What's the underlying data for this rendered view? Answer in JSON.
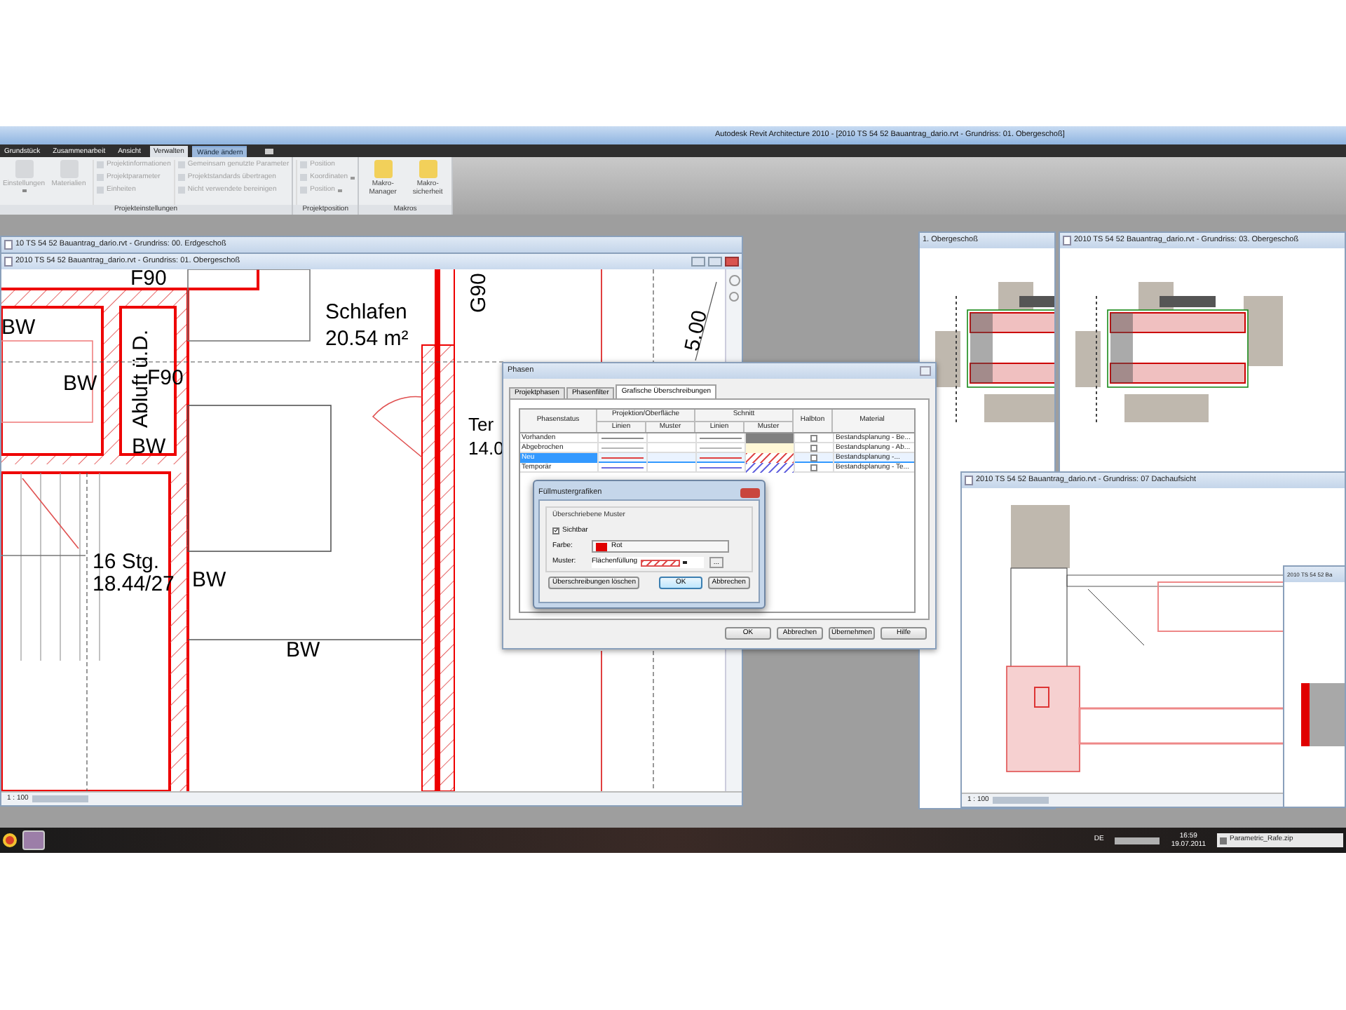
{
  "app_title": "Autodesk Revit Architecture 2010 - [2010 TS 54 52 Bauantrag_dario.rvt - Grundriss: 01. Obergeschoß]",
  "ribbon_tabs": [
    {
      "label": "Grundstück",
      "selected": false,
      "kind": "normal"
    },
    {
      "label": "Zusammenarbeit",
      "selected": false,
      "kind": "normal"
    },
    {
      "label": "Ansicht",
      "selected": false,
      "kind": "normal"
    },
    {
      "label": "Verwalten",
      "selected": true,
      "kind": "normal"
    },
    {
      "label": "Wände ändern",
      "selected": false,
      "kind": "contextual"
    }
  ],
  "ribbon_panels": [
    {
      "label": "Projekteinstellungen",
      "columns": [
        {
          "kind": "large",
          "items": [
            {
              "label": "Einstellungen",
              "dropdown": true,
              "disabled": true
            }
          ]
        },
        {
          "kind": "large",
          "items": [
            {
              "label": "Materialien",
              "dropdown": false,
              "disabled": true
            }
          ]
        },
        {
          "kind": "small",
          "items": [
            {
              "label": "Projektinformationen",
              "dropdown": false,
              "disabled": true
            },
            {
              "label": "Projektparameter",
              "dropdown": false,
              "disabled": true
            },
            {
              "label": "Einheiten",
              "dropdown": false,
              "disabled": true
            }
          ]
        },
        {
          "kind": "small",
          "items": [
            {
              "label": "Gemeinsam genutzte Parameter",
              "dropdown": false,
              "disabled": true
            },
            {
              "label": "Projektstandards übertragen",
              "dropdown": false,
              "disabled": true
            },
            {
              "label": "Nicht verwendete bereinigen",
              "dropdown": false,
              "disabled": true
            }
          ]
        }
      ]
    },
    {
      "label": "Projektposition",
      "columns": [
        {
          "kind": "small",
          "items": [
            {
              "label": "Position",
              "dropdown": false,
              "disabled": true
            },
            {
              "label": "Koordinaten",
              "dropdown": true,
              "disabled": true
            },
            {
              "label": "Position",
              "dropdown": true,
              "disabled": true
            }
          ]
        }
      ]
    },
    {
      "label": "Makros",
      "columns": [
        {
          "kind": "large",
          "items": [
            {
              "label": "Makro-Manager",
              "dropdown": false,
              "disabled": false
            }
          ]
        },
        {
          "kind": "large",
          "items": [
            {
              "label": "Makro-sicherheit",
              "dropdown": false,
              "disabled": false
            }
          ]
        }
      ]
    }
  ],
  "back_window": {
    "title": "10 TS 54 52 Bauantrag_dario.rvt - Grundriss: 00. Erdgeschoß"
  },
  "main_window": {
    "title": "2010 TS 54 52 Bauantrag_dario.rvt - Grundriss: 01. Obergeschoß",
    "scale": "1 : 100",
    "plan_labels": [
      "F90",
      "BW",
      "BW",
      "Abluft ü.D.",
      "F90",
      "BW",
      "Schlafen",
      "20.54 m²",
      "G90",
      "5.00",
      "Ter",
      "14.0",
      "16 Stg.",
      "18.44/27",
      "BW",
      "BW"
    ]
  },
  "views": [
    {
      "title": "1. Obergeschoß"
    },
    {
      "title": "2010 TS 54 52 Bauantrag_dario.rvt - Grundriss: 03. Obergeschoß"
    },
    {
      "title": "2010 TS 54 52 Bauantrag_dario.rvt - Grundriss: 07 Dachaufsicht",
      "scale": "1 : 100"
    },
    {
      "title": "2010 TS 54 52 Ba"
    }
  ],
  "phases_dialog": {
    "title": "Phasen",
    "tabs": [
      {
        "label": "Projektphasen",
        "selected": false
      },
      {
        "label": "Phasenfilter",
        "selected": false
      },
      {
        "label": "Grafische Überschreibungen",
        "selected": true
      }
    ],
    "headers": {
      "status": "Phasenstatus",
      "projection": "Projektion/Oberfläche",
      "section": "Schnitt",
      "halftone": "Halbton",
      "material": "Material",
      "sub": [
        "Linien",
        "Muster",
        "Linien",
        "Muster"
      ]
    },
    "rows": [
      {
        "status": "Vorhanden",
        "selected": false,
        "color": "#8c8c8c",
        "section_pattern": {
          "kind": "solid",
          "color": "#808080"
        },
        "halftone": false,
        "material": "Bestandsplanung - Be..."
      },
      {
        "status": "Abgebrochen",
        "selected": false,
        "color": "#b4b4b4",
        "section_pattern": {
          "kind": "solid",
          "color": "#fff7d6"
        },
        "halftone": false,
        "material": "Bestandsplanung - Ab..."
      },
      {
        "status": "Neu",
        "selected": true,
        "color": "#e04040",
        "section_pattern": {
          "kind": "hatch",
          "color": "#e05050"
        },
        "halftone": false,
        "material": "Bestandsplanung -..."
      },
      {
        "status": "Temporär",
        "selected": false,
        "color": "#6a6ae0",
        "section_pattern": {
          "kind": "hatch",
          "color": "#6a6ae0"
        },
        "halftone": false,
        "material": "Bestandsplanung - Te..."
      }
    ],
    "buttons": [
      "OK",
      "Abbrechen",
      "Übernehmen",
      "Hilfe"
    ]
  },
  "fill_dialog": {
    "title": "Füllmustergrafiken",
    "group_label": "Überschriebene Muster",
    "visible": {
      "label": "Sichtbar",
      "checked": true
    },
    "color_label": "Farbe:",
    "color_name": "Rot",
    "color": "#e00000",
    "pattern_label": "Muster:",
    "pattern_name": "Flächenfüllung",
    "browse": "...",
    "buttons": [
      {
        "label": "Überschreibungen löschen",
        "default": false
      },
      {
        "label": "OK",
        "default": true
      },
      {
        "label": "Abbrechen",
        "default": false
      }
    ]
  },
  "taskbar": {
    "language": "DE",
    "time": "16:59",
    "date": "19.07.2011",
    "file": "Parametric_Rafe.zip"
  }
}
